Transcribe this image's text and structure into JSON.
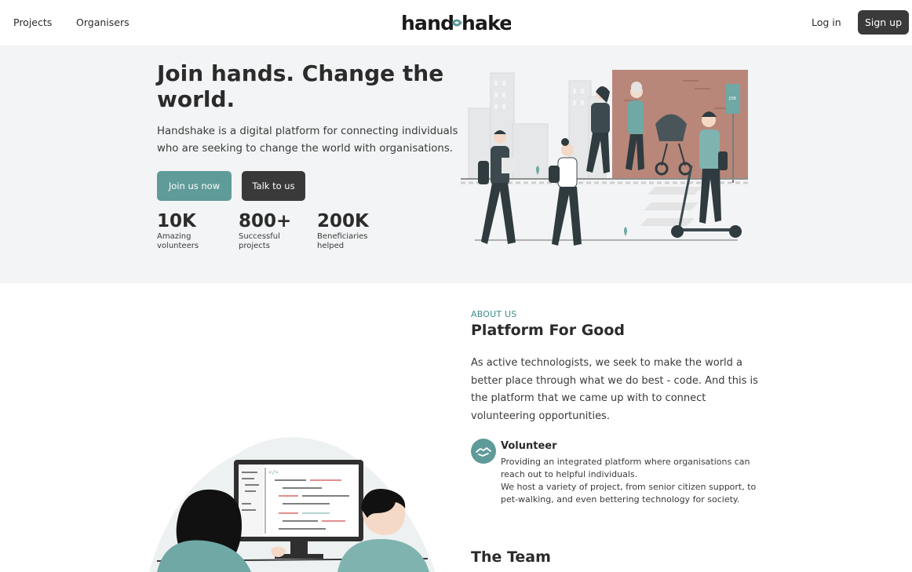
{
  "nav": {
    "projects": "Projects",
    "organisers": "Organisers",
    "logo": "handshake",
    "login": "Log in",
    "signup": "Sign up"
  },
  "hero": {
    "title": "Join hands. Change the world.",
    "description": "Handshake is a digital platform for connecting individuals who are seeking to change the world with organisations.",
    "primary_button": "Join us now",
    "secondary_button": "Talk to us",
    "stats": [
      {
        "value": "10K",
        "label": "Amazing volunteers"
      },
      {
        "value": "800+",
        "label": "Successful projects"
      },
      {
        "value": "200K",
        "label": "Beneficiaries helped"
      }
    ],
    "illustration_sign": "JOB"
  },
  "about": {
    "eyebrow": "ABOUT US",
    "title": "Platform For Good",
    "description": "As active technologists, we seek to make the world a better place through what we do best - code. And this is the platform that we came up with to connect volunteering opportunities.",
    "feature": {
      "icon": "handshake-icon",
      "title": "Volunteer",
      "text1": "Providing an integrated platform where organisations can reach out to helpful individuals.",
      "text2": "We host a variety of project, from senior citizen support, to pet-walking, and even bettering technology for society."
    }
  },
  "team": {
    "title": "The Team"
  },
  "colors": {
    "accent": "#5f9b98",
    "dark": "#393939",
    "hero_bg": "#f3f4f5",
    "eyebrow": "#3d8f8a"
  }
}
